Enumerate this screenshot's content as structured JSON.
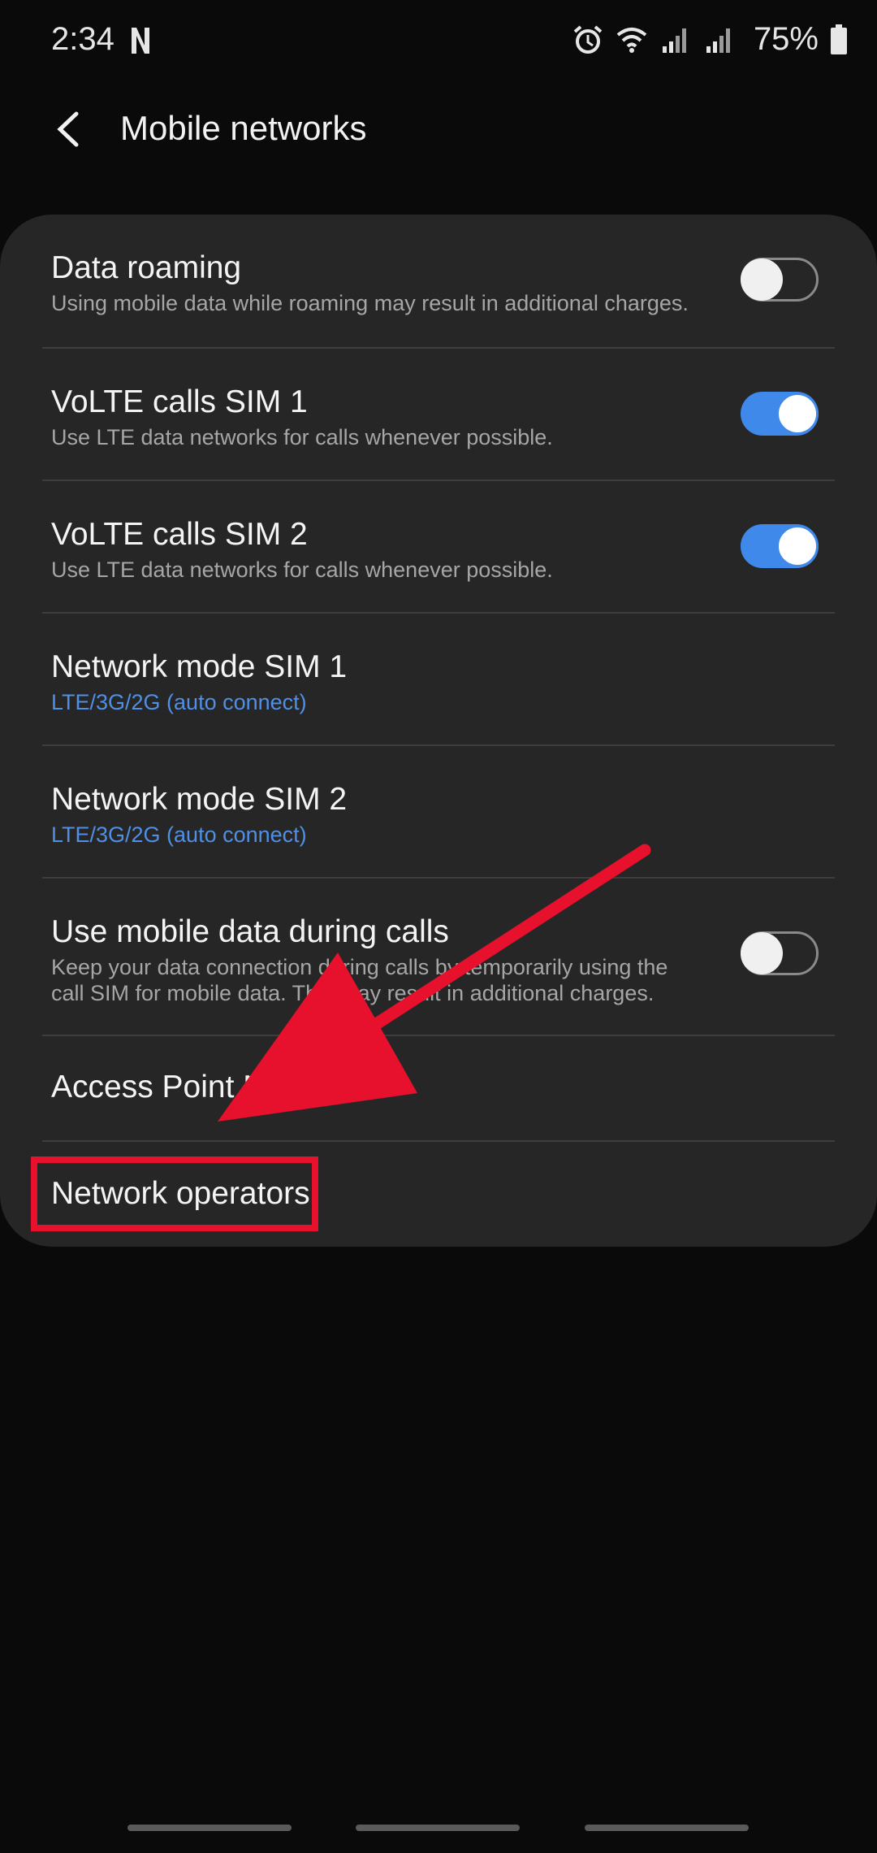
{
  "status_bar": {
    "time": "2:34",
    "battery": "75%",
    "icons": [
      "netflix-icon",
      "alarm-icon",
      "wifi-icon",
      "signal-sim1-icon",
      "signal-sim2-icon",
      "battery-icon"
    ]
  },
  "header": {
    "title": "Mobile networks",
    "back_icon": "back-arrow-icon"
  },
  "settings": {
    "data_roaming": {
      "title": "Data roaming",
      "subtitle": "Using mobile data while roaming may result in additional charges.",
      "enabled": false
    },
    "volte_sim1": {
      "title": "VoLTE calls SIM 1",
      "subtitle": "Use LTE data networks for calls whenever possible.",
      "enabled": true
    },
    "volte_sim2": {
      "title": "VoLTE calls SIM 2",
      "subtitle": "Use LTE data networks for calls whenever possible.",
      "enabled": true
    },
    "network_mode_sim1": {
      "title": "Network mode SIM 1",
      "value": "LTE/3G/2G (auto connect)"
    },
    "network_mode_sim2": {
      "title": "Network mode SIM 2",
      "value": "LTE/3G/2G (auto connect)"
    },
    "mobile_data_calls": {
      "title": "Use mobile data during calls",
      "subtitle_line1": "Keep your data connection during calls by temporarily using the",
      "subtitle_line2": "call SIM for mobile data. This may result in additional charges.",
      "enabled": false
    },
    "access_point_names": {
      "title": "Access Point Names"
    },
    "network_operators": {
      "title": "Network operators"
    }
  },
  "annotation": {
    "color": "#e8112d",
    "arrow": "red-arrow-pointing-to-network-operators"
  },
  "colors": {
    "background": "#0a0a0a",
    "card": "#262626",
    "accent": "#3e89ea",
    "link_blue": "#4f90e6"
  }
}
